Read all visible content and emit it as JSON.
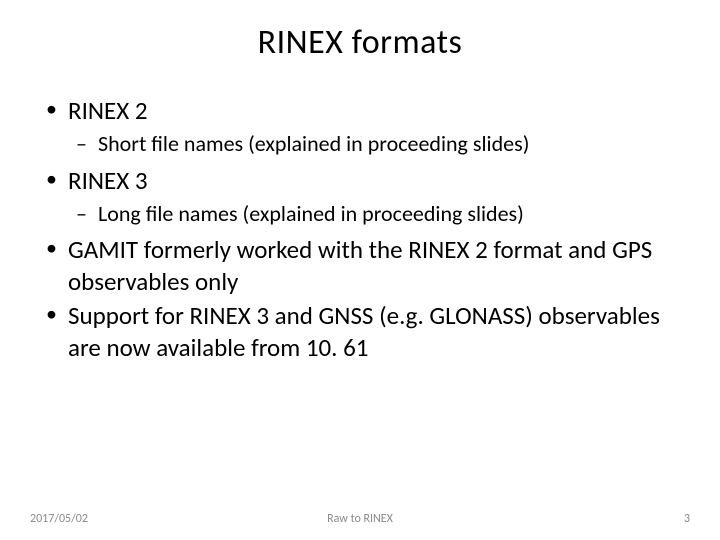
{
  "title": "RINEX formats",
  "bullets": {
    "b0": "RINEX 2",
    "b0_sub0": "Short file names (explained in proceeding slides)",
    "b1": "RINEX 3",
    "b1_sub0": "Long file names (explained in proceeding slides)",
    "b2": "GAMIT formerly worked with the RINEX 2 format and GPS observables only",
    "b3": "Support for RINEX 3 and GNSS (e.g. GLONASS) observables are now available from 10. 61"
  },
  "footer": {
    "date": "2017/05/02",
    "center": "Raw to RINEX",
    "page": "3"
  }
}
